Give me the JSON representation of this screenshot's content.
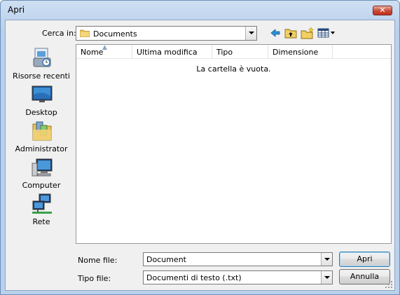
{
  "window": {
    "title": "Apri",
    "close_symbol": "✕"
  },
  "look_in": {
    "label": "Cerca in:",
    "value": "Documents"
  },
  "toolbar": {
    "icons": [
      "back-arrow-icon",
      "up-folder-icon",
      "new-folder-icon",
      "view-menu-icon"
    ]
  },
  "places": [
    {
      "label": "Risorse recenti",
      "icon": "recent-places-icon"
    },
    {
      "label": "Desktop",
      "icon": "desktop-icon"
    },
    {
      "label": "Administrator",
      "icon": "user-folder-icon"
    },
    {
      "label": "Computer",
      "icon": "computer-icon"
    },
    {
      "label": "Rete",
      "icon": "network-icon"
    }
  ],
  "file_list": {
    "columns": [
      "Nome",
      "Ultima modifica",
      "Tipo",
      "Dimensione"
    ],
    "sorted_column": "Nome",
    "empty_message": "La cartella è vuota."
  },
  "file_name": {
    "label": "Nome file:",
    "value": "Document"
  },
  "file_type": {
    "label": "Tipo file:",
    "value": "Documenti di testo  (.txt)"
  },
  "buttons": {
    "open": "Apri",
    "cancel": "Annulla"
  },
  "colors": {
    "title_gradient": "#b9d1ec",
    "close_button": "#c84a35",
    "dialog_bg": "#f0f0f0"
  }
}
